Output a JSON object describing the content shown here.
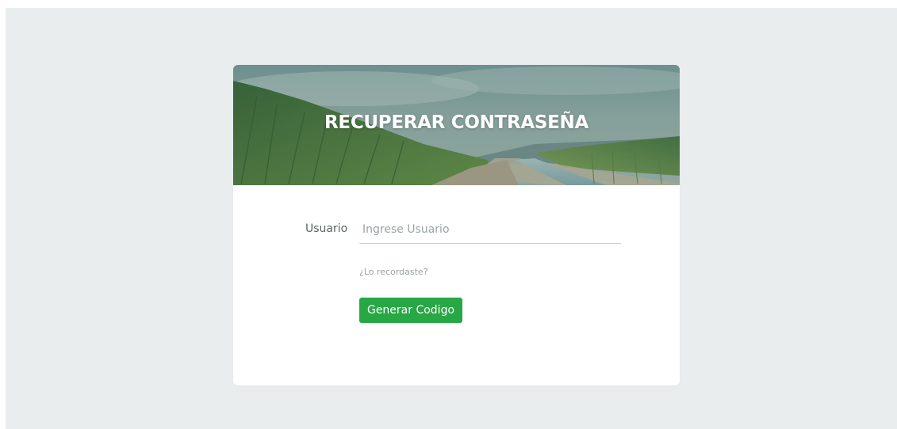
{
  "header": {
    "title": "RECUPERAR CONTRASEÑA"
  },
  "form": {
    "user_label": "Usuario",
    "user_placeholder": "Ingrese Usuario",
    "user_value": "",
    "forgot_link": "¿Lo recordaste?",
    "submit_label": "Generar Codigo"
  },
  "colors": {
    "page_background": "#e9edee",
    "card_background": "#ffffff",
    "primary_button": "#28a745",
    "banner_overlay": "#163a32"
  },
  "icons": {
    "banner_image": "sugarcane-field-landscape"
  }
}
